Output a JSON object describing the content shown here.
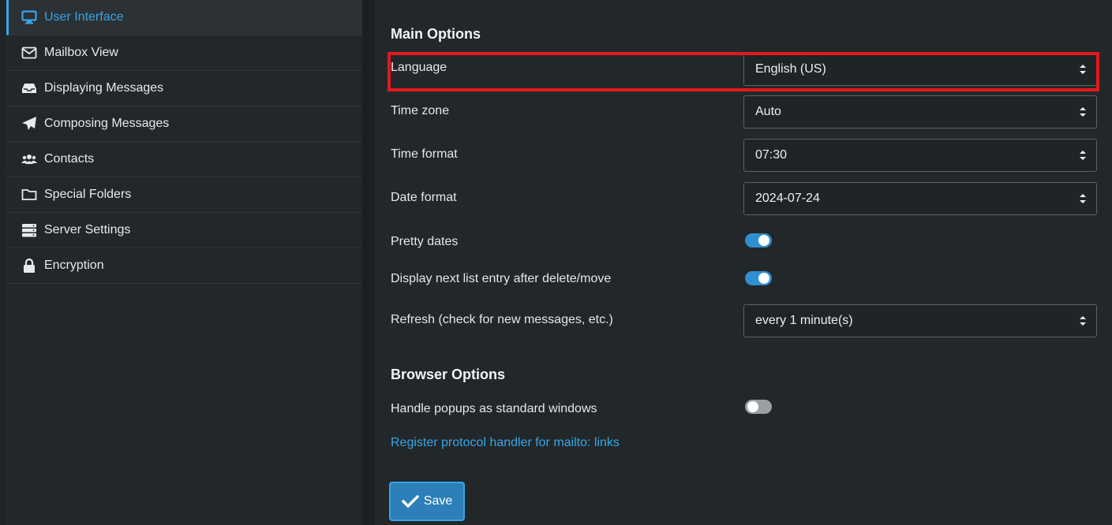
{
  "sidebar": {
    "items": [
      {
        "label": "User Interface",
        "icon": "monitor-icon",
        "active": true
      },
      {
        "label": "Mailbox View",
        "icon": "envelope-icon"
      },
      {
        "label": "Displaying Messages",
        "icon": "inbox-tray-icon"
      },
      {
        "label": "Composing Messages",
        "icon": "paper-plane-icon"
      },
      {
        "label": "Contacts",
        "icon": "users-icon"
      },
      {
        "label": "Special Folders",
        "icon": "folder-icon"
      },
      {
        "label": "Server Settings",
        "icon": "server-icon"
      },
      {
        "label": "Encryption",
        "icon": "lock-icon"
      }
    ]
  },
  "main": {
    "main_options_title": "Main Options",
    "language": {
      "label": "Language",
      "value": "English (US)"
    },
    "timezone": {
      "label": "Time zone",
      "value": "Auto"
    },
    "time_format": {
      "label": "Time format",
      "value": "07:30"
    },
    "date_format": {
      "label": "Date format",
      "value": "2024-07-24"
    },
    "pretty_dates": {
      "label": "Pretty dates",
      "on": true
    },
    "display_next": {
      "label": "Display next list entry after delete/move",
      "on": true
    },
    "refresh": {
      "label": "Refresh (check for new messages, etc.)",
      "value": "every 1 minute(s)"
    },
    "browser_options_title": "Browser Options",
    "popups": {
      "label": "Handle popups as standard windows",
      "on": false
    },
    "protocol_link": "Register protocol handler for mailto: links",
    "save_label": "Save"
  },
  "colors": {
    "accent": "#37a6e6",
    "highlight": "#e3191c",
    "toggle_on": "#2f8fd0"
  }
}
